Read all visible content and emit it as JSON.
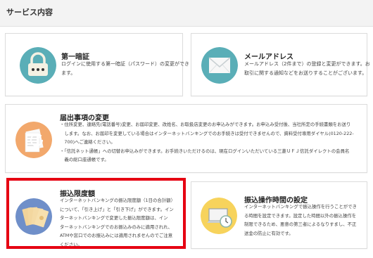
{
  "section": {
    "title": "サービス内容"
  },
  "cards": {
    "password": {
      "title": "第一暗証",
      "lines": [
        "ログインに使用する第一暗証（パスワード）の変更ができ",
        "ます。"
      ]
    },
    "email": {
      "title": "メールアドレス",
      "lines": [
        "メールアドレス（2件まで）の登録と変更ができます。お",
        "取引に関する通知などをお送りすることがございます。"
      ]
    },
    "notification": {
      "title": "届出事項の変更",
      "lines": [
        "・住所変更、連絡先(電話番号)変更、お届印変更、改姓名、お取扱店変更のお申込みができます。お申込み受付後、当社所定の手続書類をお送り",
        "　します。なお、お届印を変更している場合はインターネットバンキングでのお手続きは受付できませんので、資料受付専用ダイヤル(0120-222-",
        "　700)へご連絡ください。",
        "・「信託ネット通帳」への切替お申込みができます。お手続きいただけるのは、現在ログインいただいている三菱ＵＦＪ信託ダイレクトの会員名",
        "　義の総口座通帳です。"
      ]
    },
    "transfer_limit": {
      "title": "振込限度額",
      "lines": [
        "インターネットバンキングの振込限度額（1日の合計額）",
        "について、「引き上げ」と「引き下げ」ができます。イン",
        "ターネットバンキングで変更した振込限度額は、イン",
        "ターネットバンキングでのお振込みのみに適用されれ、",
        "ATMや窓口でのお振込みには適用されませんのでご注意",
        "ください。"
      ]
    },
    "transfer_time": {
      "title": "振込操作時間の設定",
      "lines": [
        "インターネットバンキングで振込操作を行うことができ",
        "る時間を設定できます。設定した時間以外の振込操作を",
        "制限できるため、悪意の第三者によるなりすまし、不正",
        "送金の防止に有効です。"
      ]
    }
  },
  "colors": {
    "highlight": "#e60012",
    "icon_teal": "#5aaeb7",
    "icon_orange": "#f2a86c",
    "icon_blue": "#6f8fc9",
    "icon_yellow": "#f7d35c"
  },
  "icons": {
    "password": "padlock-icon",
    "email": "envelope-icon",
    "notification": "documents-icon",
    "transfer_limit": "banknotes-icon",
    "transfer_time": "laptop-clock-icon"
  }
}
